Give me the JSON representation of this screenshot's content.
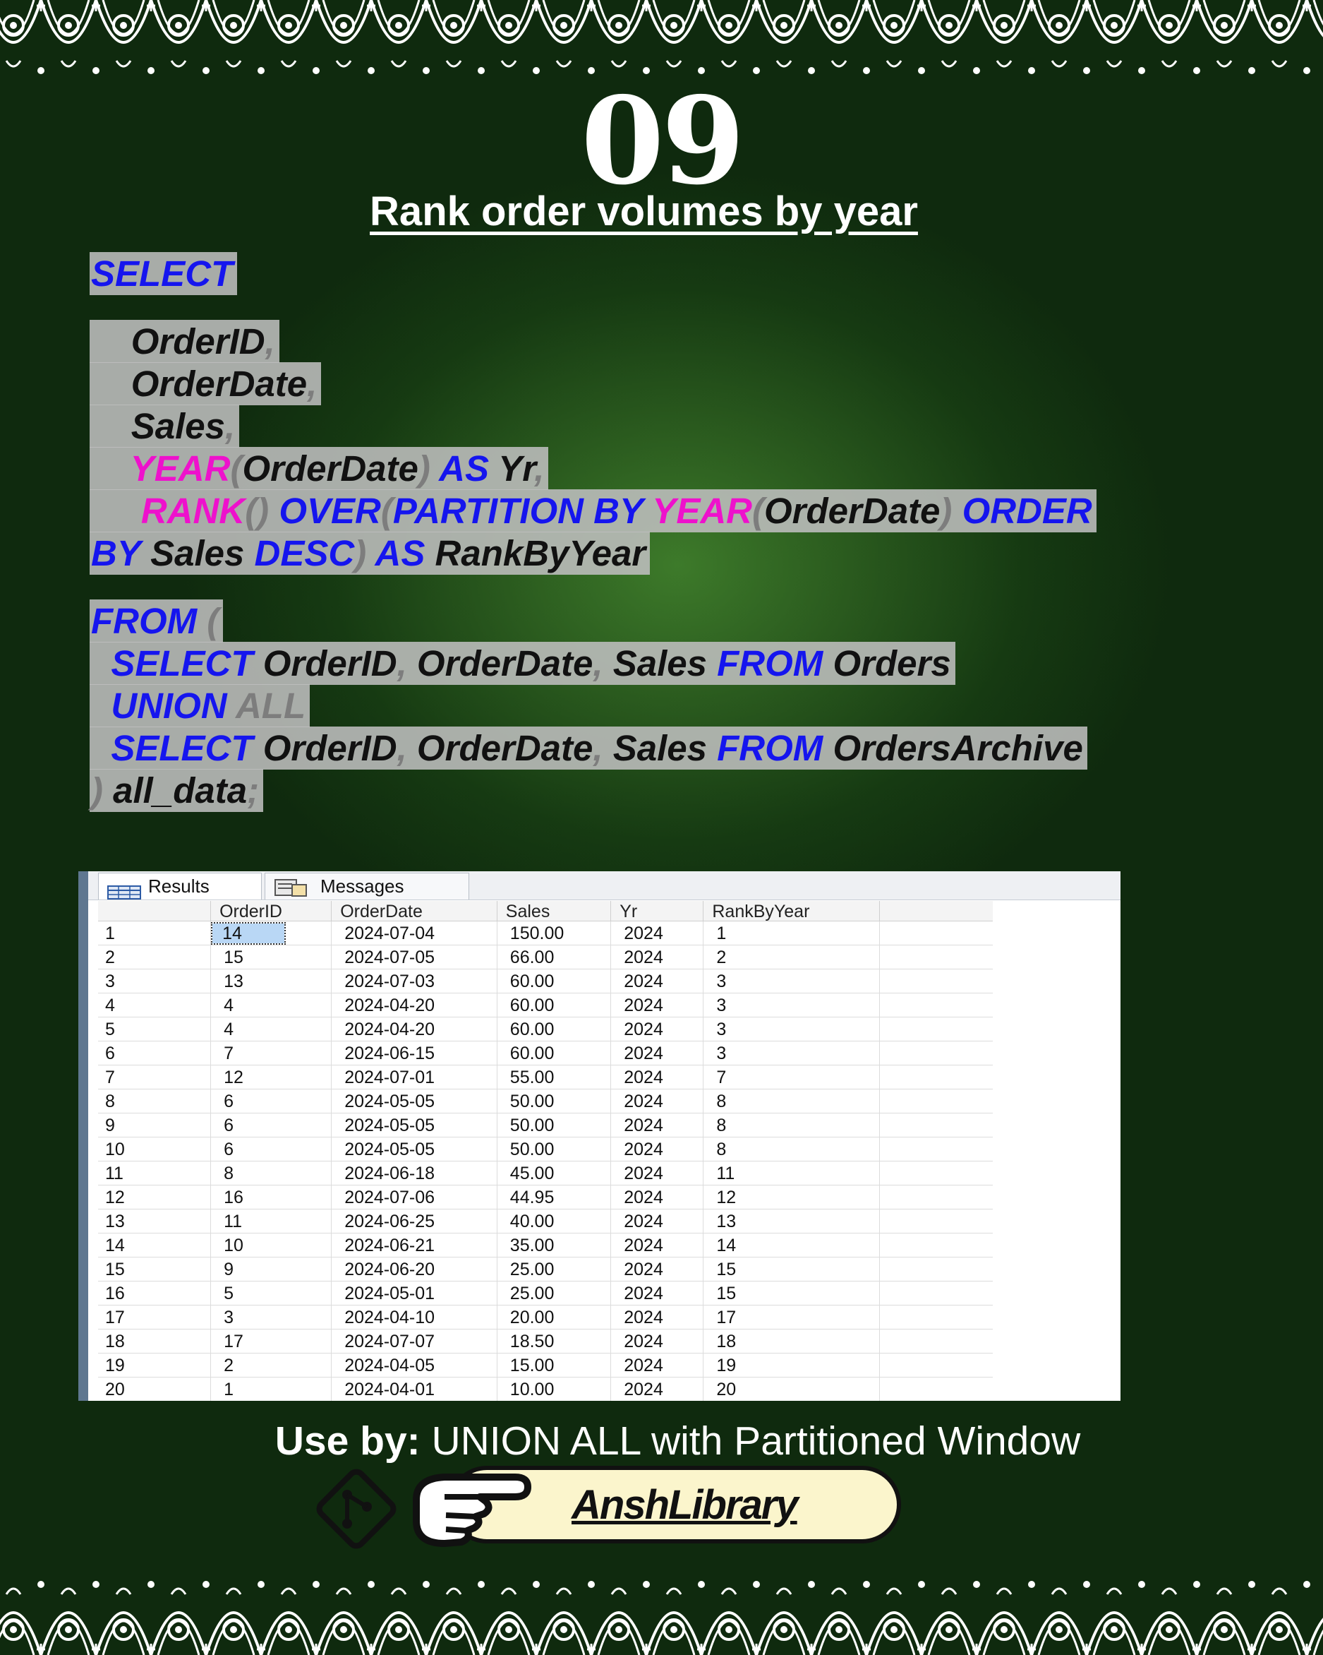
{
  "number": "09",
  "title": "Rank order volumes by year",
  "code": [
    [
      {
        "t": "SELECT",
        "k": "kw"
      }
    ],
    [],
    [
      {
        "t": "    ",
        "k": "tx"
      },
      {
        "t": "OrderID",
        "k": "tx"
      },
      {
        "t": ",",
        "k": "pn"
      }
    ],
    [
      {
        "t": "    ",
        "k": "tx"
      },
      {
        "t": "OrderDate",
        "k": "tx"
      },
      {
        "t": ",",
        "k": "pn"
      }
    ],
    [
      {
        "t": "    ",
        "k": "tx"
      },
      {
        "t": "Sales",
        "k": "tx"
      },
      {
        "t": ",",
        "k": "pn"
      }
    ],
    [
      {
        "t": "    ",
        "k": "tx"
      },
      {
        "t": "YEAR",
        "k": "fn"
      },
      {
        "t": "(",
        "k": "pn"
      },
      {
        "t": "OrderDate",
        "k": "tx"
      },
      {
        "t": ")",
        "k": "pn"
      },
      {
        "t": " AS",
        "k": "kw"
      },
      {
        "t": " Yr",
        "k": "tx"
      },
      {
        "t": ",",
        "k": "pn"
      }
    ],
    [
      {
        "t": "     ",
        "k": "tx"
      },
      {
        "t": "RANK",
        "k": "fn"
      },
      {
        "t": "()",
        "k": "pn"
      },
      {
        "t": " OVER",
        "k": "kw"
      },
      {
        "t": "(",
        "k": "pn"
      },
      {
        "t": "PARTITION BY",
        "k": "kw"
      },
      {
        "t": " YEAR",
        "k": "fn"
      },
      {
        "t": "(",
        "k": "pn"
      },
      {
        "t": "OrderDate",
        "k": "tx"
      },
      {
        "t": ")",
        "k": "pn"
      },
      {
        "t": " ORDER",
        "k": "kw"
      }
    ],
    [
      {
        "t": "BY",
        "k": "kw"
      },
      {
        "t": " Sales",
        "k": "tx"
      },
      {
        "t": " DESC",
        "k": "kw"
      },
      {
        "t": ")",
        "k": "pn"
      },
      {
        "t": " AS",
        "k": "kw"
      },
      {
        "t": " RankByYear",
        "k": "tx"
      }
    ],
    [],
    [
      {
        "t": "FROM",
        "k": "kw"
      },
      {
        "t": " (",
        "k": "pn"
      }
    ],
    [
      {
        "t": "  ",
        "k": "tx"
      },
      {
        "t": "SELECT",
        "k": "kw"
      },
      {
        "t": " OrderID",
        "k": "tx"
      },
      {
        "t": ",",
        "k": "pn"
      },
      {
        "t": " OrderDate",
        "k": "tx"
      },
      {
        "t": ",",
        "k": "pn"
      },
      {
        "t": " Sales",
        "k": "tx"
      },
      {
        "t": " FROM",
        "k": "kw"
      },
      {
        "t": " Orders",
        "k": "tx"
      }
    ],
    [
      {
        "t": "  ",
        "k": "tx"
      },
      {
        "t": "UNION",
        "k": "kw"
      },
      {
        "t": " ALL",
        "k": "pn"
      }
    ],
    [
      {
        "t": "  ",
        "k": "tx"
      },
      {
        "t": "SELECT",
        "k": "kw"
      },
      {
        "t": " OrderID",
        "k": "tx"
      },
      {
        "t": ",",
        "k": "pn"
      },
      {
        "t": " OrderDate",
        "k": "tx"
      },
      {
        "t": ",",
        "k": "pn"
      },
      {
        "t": " Sales",
        "k": "tx"
      },
      {
        "t": " FROM",
        "k": "kw"
      },
      {
        "t": " OrdersArchive",
        "k": "tx"
      }
    ],
    [
      {
        "t": ")",
        "k": "pn"
      },
      {
        "t": " all_data",
        "k": "tx"
      },
      {
        "t": ";",
        "k": "pn"
      }
    ]
  ],
  "results": {
    "tabs": [
      {
        "label": "Results",
        "icon": "grid-icon"
      },
      {
        "label": "Messages",
        "icon": "messages-icon"
      }
    ],
    "columns": [
      "OrderID",
      "OrderDate",
      "Sales",
      "Yr",
      "RankByYear"
    ],
    "rows": [
      [
        "1",
        "14",
        "2024-07-04",
        "150.00",
        "2024",
        "1"
      ],
      [
        "2",
        "15",
        "2024-07-05",
        "66.00",
        "2024",
        "2"
      ],
      [
        "3",
        "13",
        "2024-07-03",
        "60.00",
        "2024",
        "3"
      ],
      [
        "4",
        "4",
        "2024-04-20",
        "60.00",
        "2024",
        "3"
      ],
      [
        "5",
        "4",
        "2024-04-20",
        "60.00",
        "2024",
        "3"
      ],
      [
        "6",
        "7",
        "2024-06-15",
        "60.00",
        "2024",
        "3"
      ],
      [
        "7",
        "12",
        "2024-07-01",
        "55.00",
        "2024",
        "7"
      ],
      [
        "8",
        "6",
        "2024-05-05",
        "50.00",
        "2024",
        "8"
      ],
      [
        "9",
        "6",
        "2024-05-05",
        "50.00",
        "2024",
        "8"
      ],
      [
        "10",
        "6",
        "2024-05-05",
        "50.00",
        "2024",
        "8"
      ],
      [
        "11",
        "8",
        "2024-06-18",
        "45.00",
        "2024",
        "11"
      ],
      [
        "12",
        "16",
        "2024-07-06",
        "44.95",
        "2024",
        "12"
      ],
      [
        "13",
        "11",
        "2024-06-25",
        "40.00",
        "2024",
        "13"
      ],
      [
        "14",
        "10",
        "2024-06-21",
        "35.00",
        "2024",
        "14"
      ],
      [
        "15",
        "9",
        "2024-06-20",
        "25.00",
        "2024",
        "15"
      ],
      [
        "16",
        "5",
        "2024-05-01",
        "25.00",
        "2024",
        "15"
      ],
      [
        "17",
        "3",
        "2024-04-10",
        "20.00",
        "2024",
        "17"
      ],
      [
        "18",
        "17",
        "2024-07-07",
        "18.50",
        "2024",
        "18"
      ],
      [
        "19",
        "2",
        "2024-04-05",
        "15.00",
        "2024",
        "19"
      ],
      [
        "20",
        "1",
        "2024-04-01",
        "10.00",
        "2024",
        "20"
      ]
    ]
  },
  "use_by": {
    "label": "Use by:",
    "value": " UNION ALL with Partitioned Window"
  },
  "footer": {
    "brand": "AnshLibrary",
    "icons": [
      "git-icon",
      "pointing-hand-icon"
    ]
  },
  "colors": {
    "keyword": "#1515ee",
    "function": "#ee11cc",
    "punct": "#7d7d7d",
    "background": "#1f4a18",
    "pill": "#fbf5cc"
  }
}
